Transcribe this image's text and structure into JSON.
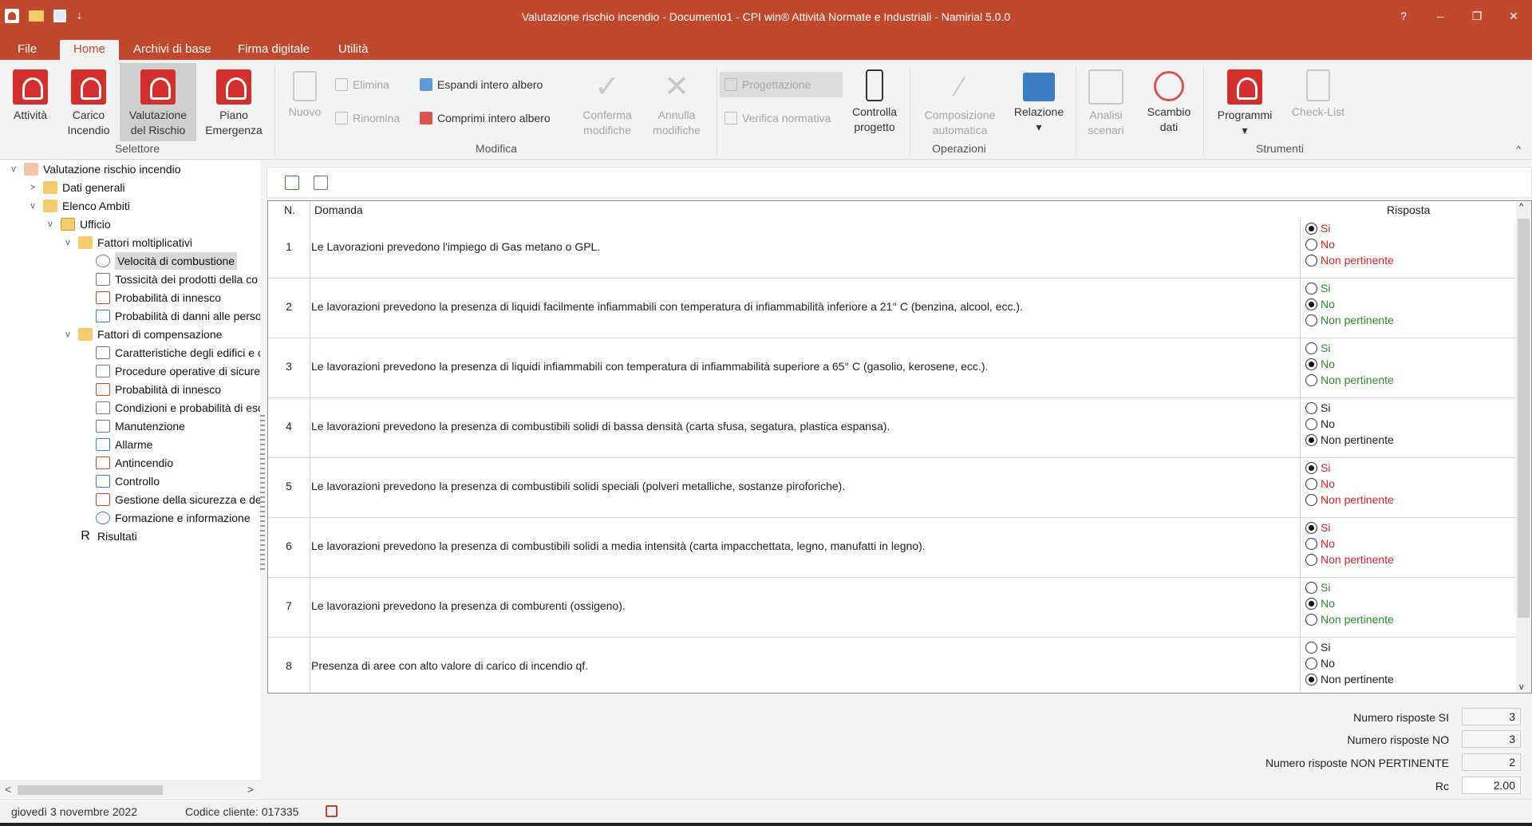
{
  "window": {
    "title": "Valutazione rischio incendio - Documento1 - CPI win® Attività  Normate e Industriali - Namirial 5.0.0",
    "help": "?",
    "minimize": "–",
    "restore": "❐",
    "close": "✕",
    "qat_more": "⇣"
  },
  "menu": [
    "File",
    "Home",
    "Archivi di base",
    "Firma digitale",
    "Utilità"
  ],
  "ribbon": {
    "selettore": {
      "label": "Selettore",
      "b1": [
        "Attività",
        ""
      ],
      "b2": [
        "Carico",
        "Incendio"
      ],
      "b3": [
        "Valutazione",
        "del Rischio"
      ],
      "b4": [
        "Piano",
        "Emergenza"
      ]
    },
    "modifica": {
      "label": "Modifica",
      "nuovo": "Nuovo",
      "elimina": "Elimina",
      "rinomina": "Rinomina",
      "espandi": "Espandi intero albero",
      "comprimi": "Comprimi intero albero",
      "conferma": [
        "Conferma",
        "modifiche"
      ],
      "annulla": [
        "Annulla",
        "modifiche"
      ]
    },
    "operazioni": {
      "label": "Operazioni",
      "progettazione": "Progettazione",
      "verifica": "Verifica normativa",
      "controlla": [
        "Controlla",
        "progetto"
      ],
      "composizione": [
        "Composizione",
        "automatica"
      ],
      "relazione": "Relazione",
      "analisi": [
        "Analisi",
        "scenari"
      ],
      "scambio": [
        "Scambio",
        "dati"
      ]
    },
    "strumenti": {
      "label": "Strumenti",
      "programmi": "Programmi",
      "checklist": "Check-List"
    },
    "collapse": "^"
  },
  "tree": {
    "root": "Valutazione rischio incendio",
    "dati_generali": "Dati generali",
    "elenco_ambiti": "Elenco Ambiti",
    "ufficio": "Ufficio",
    "fattori_molt": "Fattori moltiplicativi",
    "molt_items": [
      "Velocità di combustione",
      "Tossicità dei prodotti della co",
      "Probabilità di innesco",
      "Probabilità di danni alle perso"
    ],
    "fattori_comp": "Fattori di compensazione",
    "comp_items": [
      "Caratteristiche degli edifici e c",
      "Procedure operative di sicure",
      "Probabilità di innesco",
      "Condizioni e probabilità di esc",
      "Manutenzione",
      "Allarme",
      "Antincendio",
      "Controllo",
      "Gestione della sicurezza e dell",
      "Formazione e informazione"
    ],
    "risultati": "Risultati",
    "scroll_left": "<",
    "scroll_right": ">"
  },
  "grid": {
    "headers": {
      "n": "N.",
      "domanda": "Domanda",
      "risposta": "Risposta"
    },
    "rows": [
      {
        "n": "1",
        "q": "Le Lavorazioni prevedono l'impiego di Gas metano o GPL.",
        "sel": 0,
        "colors": [
          "#d0262a",
          "#d0262a",
          "#d0262a"
        ]
      },
      {
        "n": "2",
        "q": "Le lavorazioni prevedono la presenza di liquidi facilmente infiammabili con temperatura di infiammabilità inferiore a 21° C (benzina, alcool, ecc.).",
        "sel": 1,
        "colors": [
          "#2e8b2e",
          "#2e8b2e",
          "#2e8b2e"
        ]
      },
      {
        "n": "3",
        "q": "Le lavorazioni prevedono la presenza di liquidi infiammabili con temperatura di infiammabilità superiore a 65° C (gasolio, kerosene, ecc.).",
        "sel": 1,
        "colors": [
          "#2e8b2e",
          "#2e8b2e",
          "#2e8b2e"
        ]
      },
      {
        "n": "4",
        "q": "Le lavorazioni prevedono la presenza di combustibili solidi di bassa densità (carta sfusa, segatura, plastica espansa).",
        "sel": 2,
        "colors": [
          "#222222",
          "#222222",
          "#222222"
        ]
      },
      {
        "n": "5",
        "q": "Le lavorazioni prevedono la presenza di combustibili solidi speciali (polveri metalliche, sostanze piroforiche).",
        "sel": 0,
        "colors": [
          "#d0262a",
          "#d0262a",
          "#d0262a"
        ]
      },
      {
        "n": "6",
        "q": "Le lavorazioni prevedono la presenza di combustibili solidi a media intensità (carta impacchettata, legno, manufatti in legno).",
        "sel": 0,
        "colors": [
          "#d0262a",
          "#d0262a",
          "#d0262a"
        ]
      },
      {
        "n": "7",
        "q": "Le lavorazioni prevedono la presenza di comburenti (ossigeno).",
        "sel": 1,
        "colors": [
          "#2e8b2e",
          "#2e8b2e",
          "#2e8b2e"
        ]
      },
      {
        "n": "8",
        "q": "Presenza di aree con alto valore di carico di incendio qf.",
        "sel": 2,
        "colors": [
          "#222222",
          "#222222",
          "#222222"
        ]
      }
    ],
    "options": [
      "Si",
      "No",
      "Non pertinente"
    ],
    "scroll_up": "^",
    "scroll_down": "v"
  },
  "summary": [
    {
      "label": "Numero risposte SI",
      "value": "3"
    },
    {
      "label": "Numero risposte NO",
      "value": "3"
    },
    {
      "label": "Numero risposte NON PERTINENTE",
      "value": "2"
    },
    {
      "label": "Rc",
      "value": "2.00"
    }
  ],
  "status": {
    "date": "giovedì 3 novembre 2022",
    "client": "Codice cliente: 017335"
  }
}
